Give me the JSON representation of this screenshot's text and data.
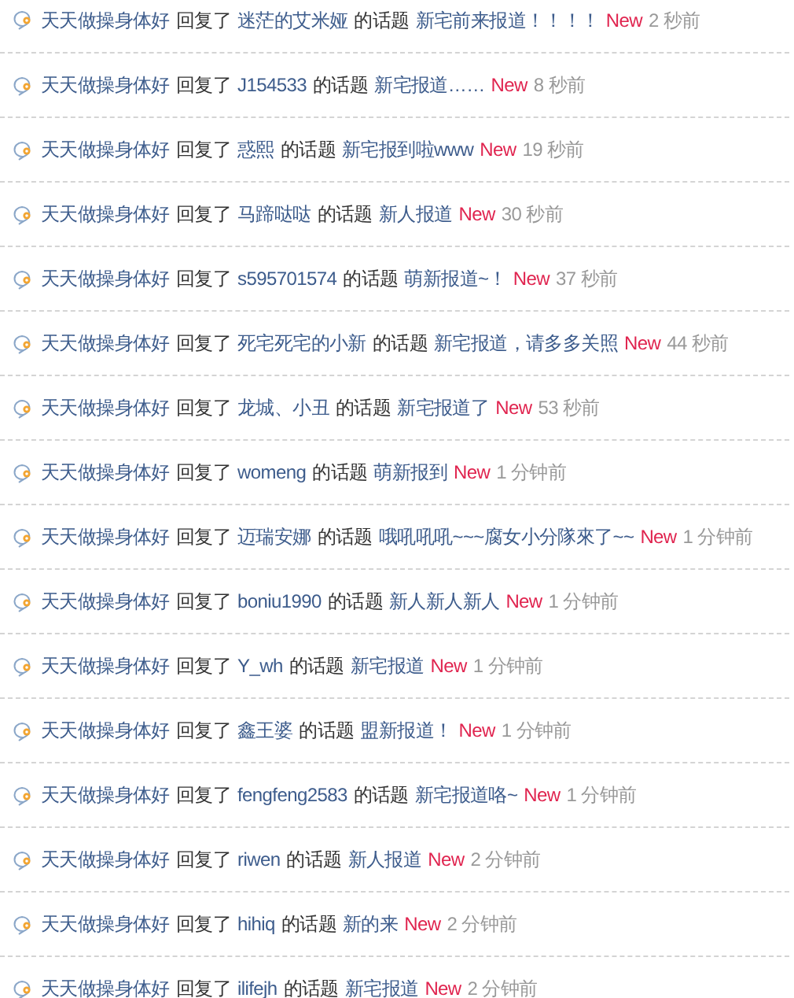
{
  "activities": [
    {
      "user": "天天做操身体好",
      "action": "回复了",
      "target": "迷茫的艾米娅",
      "object": "的话题",
      "topic": "新宅前来报道！！！！",
      "badge": "New",
      "time": "2 秒前"
    },
    {
      "user": "天天做操身体好",
      "action": "回复了",
      "target": "J154533",
      "object": "的话题",
      "topic": "新宅报道……",
      "badge": "New",
      "time": "8 秒前"
    },
    {
      "user": "天天做操身体好",
      "action": "回复了",
      "target": "惑熙",
      "object": "的话题",
      "topic": "新宅报到啦www",
      "badge": "New",
      "time": "19 秒前"
    },
    {
      "user": "天天做操身体好",
      "action": "回复了",
      "target": "马蹄哒哒",
      "object": "的话题",
      "topic": "新人报道",
      "badge": "New",
      "time": "30 秒前"
    },
    {
      "user": "天天做操身体好",
      "action": "回复了",
      "target": "s595701574",
      "object": "的话题",
      "topic": "萌新报道~！",
      "badge": "New",
      "time": "37 秒前"
    },
    {
      "user": "天天做操身体好",
      "action": "回复了",
      "target": "死宅死宅的小新",
      "object": "的话题",
      "topic": "新宅报道，请多多关照",
      "badge": "New",
      "time": "44 秒前"
    },
    {
      "user": "天天做操身体好",
      "action": "回复了",
      "target": "龙城、小丑",
      "object": "的话题",
      "topic": "新宅报道了",
      "badge": "New",
      "time": "53 秒前"
    },
    {
      "user": "天天做操身体好",
      "action": "回复了",
      "target": "womeng",
      "object": "的话题",
      "topic": "萌新报到",
      "badge": "New",
      "time": "1 分钟前"
    },
    {
      "user": "天天做操身体好",
      "action": "回复了",
      "target": "迈瑞安娜",
      "object": "的话题",
      "topic": "哦吼吼吼~~~腐女小分隊來了~~",
      "badge": "New",
      "time": "1 分钟前"
    },
    {
      "user": "天天做操身体好",
      "action": "回复了",
      "target": "boniu1990",
      "object": "的话题",
      "topic": "新人新人新人",
      "badge": "New",
      "time": "1 分钟前"
    },
    {
      "user": "天天做操身体好",
      "action": "回复了",
      "target": "Y_wh",
      "object": "的话题",
      "topic": "新宅报道",
      "badge": "New",
      "time": "1 分钟前"
    },
    {
      "user": "天天做操身体好",
      "action": "回复了",
      "target": "鑫王婆",
      "object": "的话题",
      "topic": "盟新报道！",
      "badge": "New",
      "time": "1 分钟前"
    },
    {
      "user": "天天做操身体好",
      "action": "回复了",
      "target": "fengfeng2583",
      "object": "的话题",
      "topic": "新宅报道咯~",
      "badge": "New",
      "time": "1 分钟前"
    },
    {
      "user": "天天做操身体好",
      "action": "回复了",
      "target": "riwen",
      "object": "的话题",
      "topic": "新人报道",
      "badge": "New",
      "time": "2 分钟前"
    },
    {
      "user": "天天做操身体好",
      "action": "回复了",
      "target": "hihiq",
      "object": "的话题",
      "topic": "新的来",
      "badge": "New",
      "time": "2 分钟前"
    },
    {
      "user": "天天做操身体好",
      "action": "回复了",
      "target": "ilifejh",
      "object": "的话题",
      "topic": "新宅报道",
      "badge": "New",
      "time": "2 分钟前"
    }
  ]
}
